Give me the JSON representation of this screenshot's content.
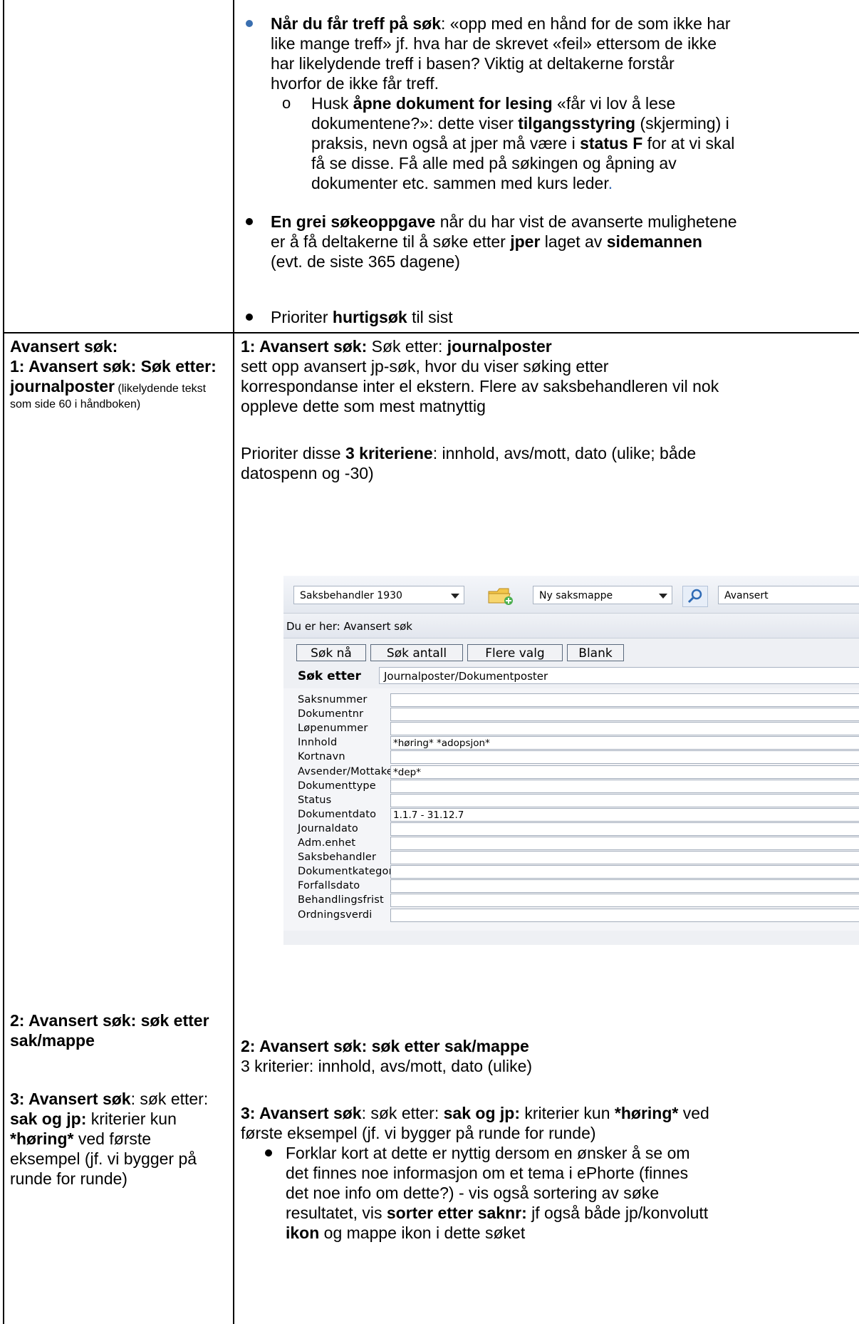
{
  "row1": {
    "b1_line1_bold": "Når du får treff på søk",
    "b1_line1_rest": ": «opp med en hånd for de som ikke har",
    "b1_line2": "like mange treff» jf. hva har de skrevet «feil» ettersom de ikke",
    "b1_line3": "har likelydende treff i basen? Viktig at deltakerne forstår",
    "b1_line4": "hvorfor de ikke får treff.",
    "sub_marker": "o",
    "sub_line1_a": "Husk ",
    "sub_line1_b": "åpne dokument for lesing",
    "sub_line1_c": " «får vi lov å lese",
    "sub_line2_a": "dokumentene?»: dette viser ",
    "sub_line2_b": "tilgangsstyring",
    "sub_line2_c": " (skjerming) i",
    "sub_line3_a": "praksis, nevn også at jper må være i ",
    "sub_line3_b": "status F",
    "sub_line3_c": " for at vi skal",
    "sub_line4": "få se disse. Få alle med på søkingen og åpning av",
    "sub_line5": "dokumenter etc. sammen med kurs leder",
    "sub_line5_dot": ".",
    "b2_line1_bold": "En grei søkeoppgave",
    "b2_line1_rest": " når du har vist de avanserte mulighetene",
    "b2_line2_a": "er å få deltakerne til å søke etter ",
    "b2_line2_b": "jper",
    "b2_line2_c": " laget av ",
    "b2_line2_d": "sidemannen",
    "b2_line3": "(evt. de siste 365 dagene)",
    "b3_a": "Prioriter ",
    "b3_b": "hurtigsøk",
    "b3_c": " til sist"
  },
  "row2_left": {
    "title": "Avansert søk:",
    "line2": "1: Avansert søk: Søk etter:",
    "line3_bold": "journalposter",
    "line3_small": " (likelydende tekst",
    "line4_small": "som side 60 i håndboken)",
    "s2_line1": "2: Avansert søk: søk etter",
    "s2_line2": "sak/mappe",
    "s3_line1_b": "3: Avansert søk",
    "s3_line1_r": ": søk etter:",
    "s3_line2_b": "sak og jp:",
    "s3_line2_r": " kriterier kun",
    "s3_line3_b": "*høring*",
    "s3_line3_r": " ved første",
    "s3_line4": "eksempel (jf. vi bygger på",
    "s3_line5": "runde for runde)"
  },
  "row2_right": {
    "p1_a": "1: Avansert søk:",
    "p1_b": " Søk etter: ",
    "p1_c": "journalposter",
    "p1_line2": "sett opp avansert jp-søk, hvor du viser søking etter",
    "p1_line3": "korrespondanse inter el ekstern.  Flere av saksbehandleren vil nok",
    "p1_line4": "oppleve dette som mest matnyttig",
    "p2_a": " Prioriter disse ",
    "p2_b": "3 kriteriene",
    "p2_c": ": innhold, avs/mott, dato (ulike; både",
    "p2_line2": "datospenn og -30)",
    "s2_title": "2: Avansert søk: søk etter sak/mappe",
    "s2_line2": "3 kriterier: innhold, avs/mott, dato (ulike)",
    "s3_a": "3: Avansert søk",
    "s3_b": ": søk etter: ",
    "s3_c": "sak og jp:",
    "s3_d": " kriterier kun ",
    "s3_e": "*høring*",
    "s3_f": " ved",
    "s3_line2": "første eksempel (jf. vi bygger på runde for runde)",
    "s3_b1_line1": "Forklar kort at dette er nyttig dersom en ønsker å se om",
    "s3_b1_line2": "det finnes noe informasjon om et tema i ePhorte (finnes",
    "s3_b1_line3": "det noe info om dette?) - vis også sortering av søke",
    "s3_b1_line4_a": "resultatet, vis ",
    "s3_b1_line4_b": "sorter etter saknr:",
    "s3_b1_line4_c": " jf også både jp/konvolutt",
    "s3_b1_line5_b": "ikon",
    "s3_b1_line5_r": " og mappe ikon i dette søket"
  },
  "screenshot": {
    "user_combo": "Saksbehandler 1930",
    "new_combo": "Ny saksmappe",
    "search_combo": "Avansert",
    "breadcrumb": "Du er her: Avansert søk",
    "btn_sok_na": "Søk nå",
    "btn_sok_antall": "Søk antall",
    "btn_flere_valg": "Flere valg",
    "btn_blank": "Blank",
    "sok_etter_label": "Søk etter",
    "sok_etter_value": "Journalposter/Dokumentposter",
    "fields": [
      {
        "label": "Saksnummer",
        "value": ""
      },
      {
        "label": "Dokumentnr",
        "value": ""
      },
      {
        "label": "Løpenummer",
        "value": ""
      },
      {
        "label": "Innhold",
        "value": "*høring* *adopsjon*"
      },
      {
        "label": "Kortnavn",
        "value": ""
      },
      {
        "label": "Avsender/Mottaker",
        "value": "*dep*"
      },
      {
        "label": "Dokumenttype",
        "value": ""
      },
      {
        "label": "Status",
        "value": ""
      },
      {
        "label": "Dokumentdato",
        "value": "1.1.7 - 31.12.7"
      },
      {
        "label": "Journaldato",
        "value": ""
      },
      {
        "label": "Adm.enhet",
        "value": ""
      },
      {
        "label": "Saksbehandler",
        "value": ""
      },
      {
        "label": "Dokumentkategori",
        "value": ""
      },
      {
        "label": "Forfallsdato",
        "value": ""
      },
      {
        "label": "Behandlingsfrist",
        "value": ""
      },
      {
        "label": "Ordningsverdi",
        "value": ""
      }
    ]
  },
  "colors": {
    "bullet_blue": "#3a6fb0",
    "border": "#000000"
  }
}
